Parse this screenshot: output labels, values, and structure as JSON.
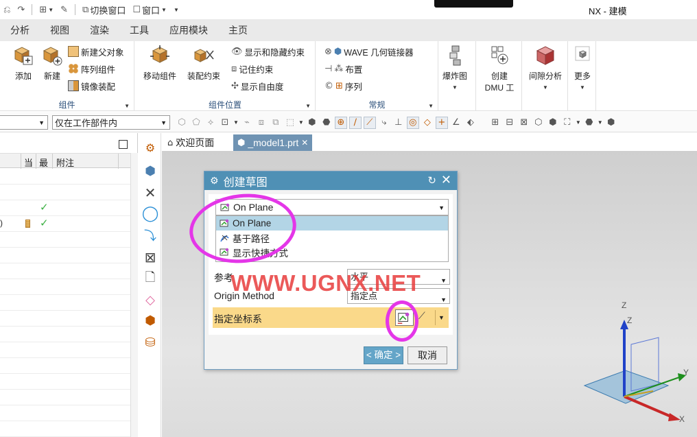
{
  "titlebar": {
    "switch_window": "切换窗口",
    "window_menu": "窗口",
    "app_title": "NX - 建模"
  },
  "tabs": [
    "分析",
    "视图",
    "渲染",
    "工具",
    "应用模块",
    "主页"
  ],
  "ribbon": {
    "components": {
      "label": "组件",
      "add": "添加",
      "new": "新建",
      "new_parent": "新建父对象",
      "array_component": "阵列组件",
      "mirror_assembly": "镜像装配"
    },
    "component_position": {
      "label": "组件位置",
      "move_component": "移动组件",
      "assembly_constraint": "装配约束",
      "show_hide_constraints": "显示和隐藏约束",
      "remember_constraints": "记住约束",
      "show_dof": "显示自由度"
    },
    "general": {
      "label": "常规",
      "wave_linker": "WAVE 几何链接器",
      "arrangement": "布置",
      "sequence": "序列"
    },
    "exploded_view": "爆炸图",
    "create_dmu_line1": "创建",
    "create_dmu_line2": "DMU 工",
    "clearance_analysis": "间隙分析",
    "more": "更多"
  },
  "selection_bar": {
    "filter_value": "",
    "scope_value": "仅在工作部件内"
  },
  "navigator": {
    "columns": [
      "当",
      "最",
      "附注"
    ],
    "rows": [
      {
        "check": false,
        "icon": false,
        "mark": ""
      },
      {
        "check": false,
        "icon": false,
        "mark": ""
      },
      {
        "check": true,
        "icon": false,
        "mark": ""
      },
      {
        "check": true,
        "icon": true,
        "mark": ")"
      },
      {
        "check": false,
        "icon": false,
        "mark": ""
      },
      {
        "check": false,
        "icon": false,
        "mark": ""
      },
      {
        "check": false,
        "icon": false,
        "mark": ""
      },
      {
        "check": false,
        "icon": false,
        "mark": ""
      },
      {
        "check": false,
        "icon": false,
        "mark": ""
      },
      {
        "check": false,
        "icon": false,
        "mark": ""
      },
      {
        "check": false,
        "icon": false,
        "mark": ""
      },
      {
        "check": false,
        "icon": false,
        "mark": ""
      },
      {
        "check": false,
        "icon": false,
        "mark": ""
      },
      {
        "check": false,
        "icon": false,
        "mark": ""
      },
      {
        "check": false,
        "icon": false,
        "mark": ""
      },
      {
        "check": false,
        "icon": false,
        "mark": ""
      },
      {
        "check": false,
        "icon": false,
        "mark": ""
      }
    ]
  },
  "doc_tabs": {
    "welcome": "欢迎页面",
    "model": "_model1.prt"
  },
  "dialog": {
    "title": "创建草图",
    "type_selected": "On Plane",
    "type_options": [
      "On Plane",
      "基于路径",
      "显示快捷方式"
    ],
    "reference_label": "参考",
    "reference_value": "水平",
    "origin_method_label": "Origin Method",
    "origin_method_value": "指定点",
    "specify_csys_label": "指定坐标系",
    "ok_label": "< 确定 >",
    "cancel_label": "取消"
  },
  "watermark": "WWW.UGNX.NET",
  "triad": {
    "z": "Z",
    "y": "Y",
    "x": "X"
  },
  "colors": {
    "dialog_title": "#4f90b5",
    "highlight_row": "#fad98a",
    "annotation": "#e436e8",
    "watermark": "#e83c3c"
  }
}
